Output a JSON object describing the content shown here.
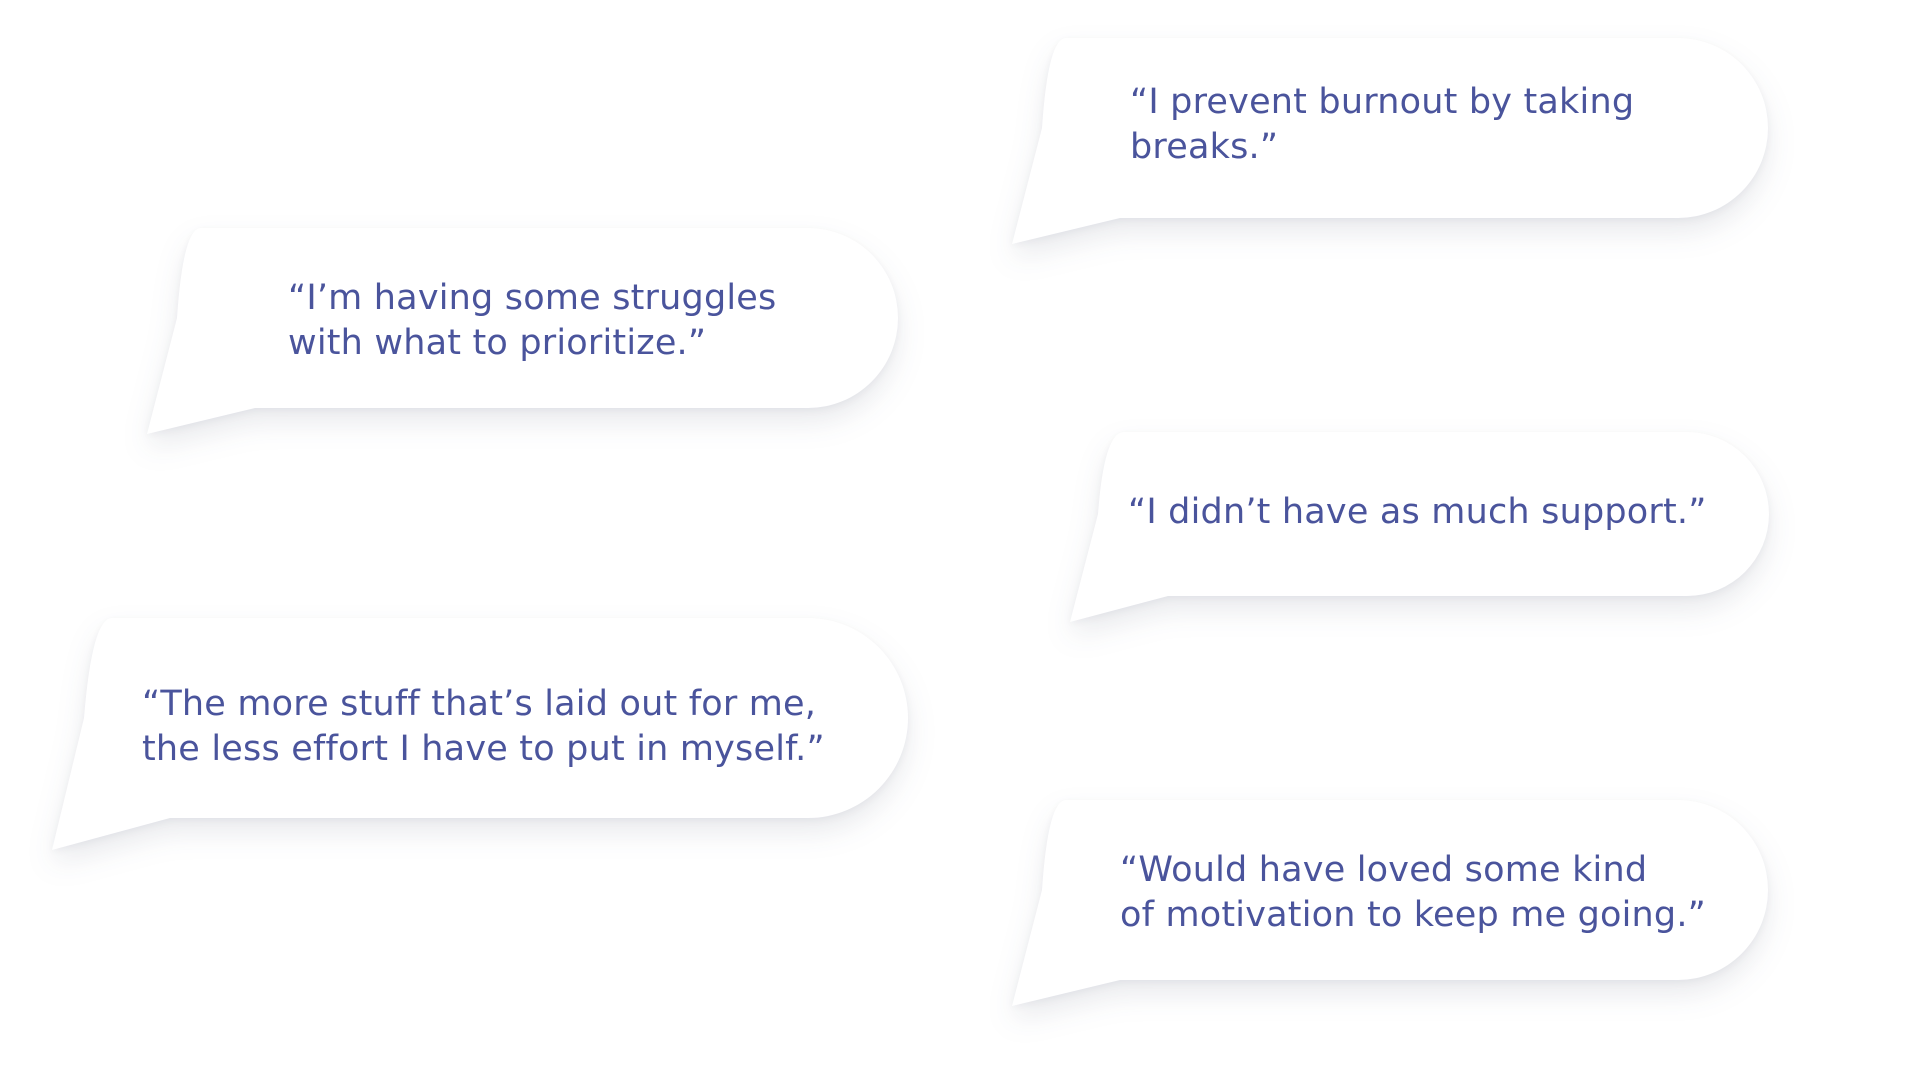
{
  "colors": {
    "background": "#ffffff",
    "bubble_fill": "#ffffff",
    "quote_text": "#4a549c"
  },
  "quotes": [
    {
      "lines": [
        "“I prevent burnout by taking",
        "breaks.”"
      ]
    },
    {
      "lines": [
        "“I’m having some struggles",
        "with what to prioritize.”"
      ]
    },
    {
      "lines": [
        "“I didn’t have as much support.”"
      ]
    },
    {
      "lines": [
        "“The more stuff that’s laid out for me,",
        "the less effort I have to put in myself.”"
      ]
    },
    {
      "lines": [
        "“Would have loved some kind",
        "of motivation to keep me going.”"
      ]
    }
  ]
}
